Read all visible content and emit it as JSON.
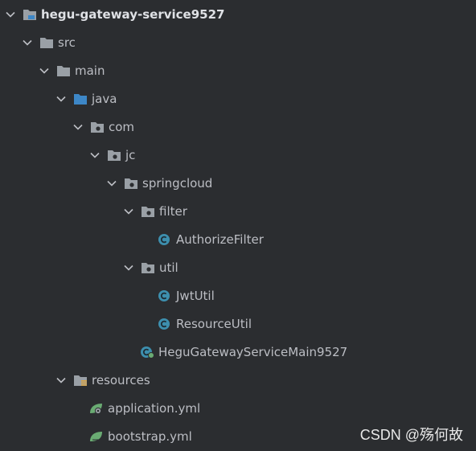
{
  "tree": {
    "root": "hegu-gateway-service9527",
    "src": "src",
    "main": "main",
    "java": "java",
    "com": "com",
    "jc": "jc",
    "springcloud": "springcloud",
    "filter": "filter",
    "authorize_filter": "AuthorizeFilter",
    "util": "util",
    "jwt_util": "JwtUtil",
    "resource_util": "ResourceUtil",
    "main_class": "HeguGatewayServiceMain9527",
    "resources": "resources",
    "application_yml": "application.yml",
    "bootstrap_yml": "bootstrap.yml"
  },
  "watermark": "CSDN @殇何故",
  "colors": {
    "background": "#2b2d30",
    "text": "#bcbec4",
    "folder": "#9aa0a6",
    "source_folder": "#3d87c7",
    "class_icon": "#3d8fae",
    "spring_leaf": "#6aab73"
  }
}
